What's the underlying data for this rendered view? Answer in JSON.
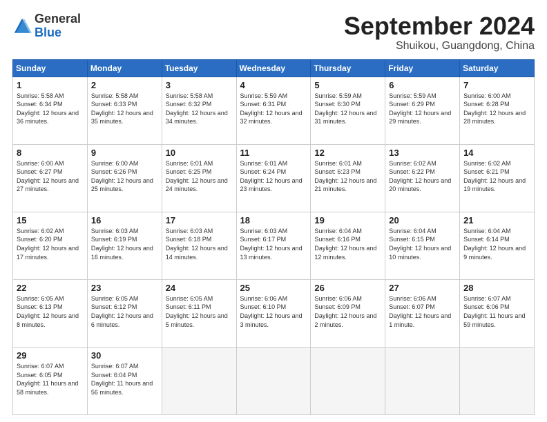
{
  "header": {
    "logo_general": "General",
    "logo_blue": "Blue",
    "month_title": "September 2024",
    "subtitle": "Shuikou, Guangdong, China"
  },
  "calendar": {
    "days_of_week": [
      "Sunday",
      "Monday",
      "Tuesday",
      "Wednesday",
      "Thursday",
      "Friday",
      "Saturday"
    ],
    "weeks": [
      [
        null,
        {
          "day": "2",
          "sunrise": "5:58 AM",
          "sunset": "6:33 PM",
          "daylight": "12 hours and 35 minutes."
        },
        {
          "day": "3",
          "sunrise": "5:58 AM",
          "sunset": "6:32 PM",
          "daylight": "12 hours and 34 minutes."
        },
        {
          "day": "4",
          "sunrise": "5:59 AM",
          "sunset": "6:31 PM",
          "daylight": "12 hours and 32 minutes."
        },
        {
          "day": "5",
          "sunrise": "5:59 AM",
          "sunset": "6:30 PM",
          "daylight": "12 hours and 31 minutes."
        },
        {
          "day": "6",
          "sunrise": "5:59 AM",
          "sunset": "6:29 PM",
          "daylight": "12 hours and 29 minutes."
        },
        {
          "day": "7",
          "sunrise": "6:00 AM",
          "sunset": "6:28 PM",
          "daylight": "12 hours and 28 minutes."
        }
      ],
      [
        {
          "day": "1",
          "sunrise": "5:58 AM",
          "sunset": "6:34 PM",
          "daylight": "12 hours and 36 minutes."
        },
        null,
        null,
        null,
        null,
        null,
        null
      ],
      [
        {
          "day": "8",
          "sunrise": "6:00 AM",
          "sunset": "6:27 PM",
          "daylight": "12 hours and 27 minutes."
        },
        {
          "day": "9",
          "sunrise": "6:00 AM",
          "sunset": "6:26 PM",
          "daylight": "12 hours and 25 minutes."
        },
        {
          "day": "10",
          "sunrise": "6:01 AM",
          "sunset": "6:25 PM",
          "daylight": "12 hours and 24 minutes."
        },
        {
          "day": "11",
          "sunrise": "6:01 AM",
          "sunset": "6:24 PM",
          "daylight": "12 hours and 23 minutes."
        },
        {
          "day": "12",
          "sunrise": "6:01 AM",
          "sunset": "6:23 PM",
          "daylight": "12 hours and 21 minutes."
        },
        {
          "day": "13",
          "sunrise": "6:02 AM",
          "sunset": "6:22 PM",
          "daylight": "12 hours and 20 minutes."
        },
        {
          "day": "14",
          "sunrise": "6:02 AM",
          "sunset": "6:21 PM",
          "daylight": "12 hours and 19 minutes."
        }
      ],
      [
        {
          "day": "15",
          "sunrise": "6:02 AM",
          "sunset": "6:20 PM",
          "daylight": "12 hours and 17 minutes."
        },
        {
          "day": "16",
          "sunrise": "6:03 AM",
          "sunset": "6:19 PM",
          "daylight": "12 hours and 16 minutes."
        },
        {
          "day": "17",
          "sunrise": "6:03 AM",
          "sunset": "6:18 PM",
          "daylight": "12 hours and 14 minutes."
        },
        {
          "day": "18",
          "sunrise": "6:03 AM",
          "sunset": "6:17 PM",
          "daylight": "12 hours and 13 minutes."
        },
        {
          "day": "19",
          "sunrise": "6:04 AM",
          "sunset": "6:16 PM",
          "daylight": "12 hours and 12 minutes."
        },
        {
          "day": "20",
          "sunrise": "6:04 AM",
          "sunset": "6:15 PM",
          "daylight": "12 hours and 10 minutes."
        },
        {
          "day": "21",
          "sunrise": "6:04 AM",
          "sunset": "6:14 PM",
          "daylight": "12 hours and 9 minutes."
        }
      ],
      [
        {
          "day": "22",
          "sunrise": "6:05 AM",
          "sunset": "6:13 PM",
          "daylight": "12 hours and 8 minutes."
        },
        {
          "day": "23",
          "sunrise": "6:05 AM",
          "sunset": "6:12 PM",
          "daylight": "12 hours and 6 minutes."
        },
        {
          "day": "24",
          "sunrise": "6:05 AM",
          "sunset": "6:11 PM",
          "daylight": "12 hours and 5 minutes."
        },
        {
          "day": "25",
          "sunrise": "6:06 AM",
          "sunset": "6:10 PM",
          "daylight": "12 hours and 3 minutes."
        },
        {
          "day": "26",
          "sunrise": "6:06 AM",
          "sunset": "6:09 PM",
          "daylight": "12 hours and 2 minutes."
        },
        {
          "day": "27",
          "sunrise": "6:06 AM",
          "sunset": "6:07 PM",
          "daylight": "12 hours and 1 minute."
        },
        {
          "day": "28",
          "sunrise": "6:07 AM",
          "sunset": "6:06 PM",
          "daylight": "11 hours and 59 minutes."
        }
      ],
      [
        {
          "day": "29",
          "sunrise": "6:07 AM",
          "sunset": "6:05 PM",
          "daylight": "11 hours and 58 minutes."
        },
        {
          "day": "30",
          "sunrise": "6:07 AM",
          "sunset": "6:04 PM",
          "daylight": "11 hours and 56 minutes."
        },
        null,
        null,
        null,
        null,
        null
      ]
    ]
  }
}
